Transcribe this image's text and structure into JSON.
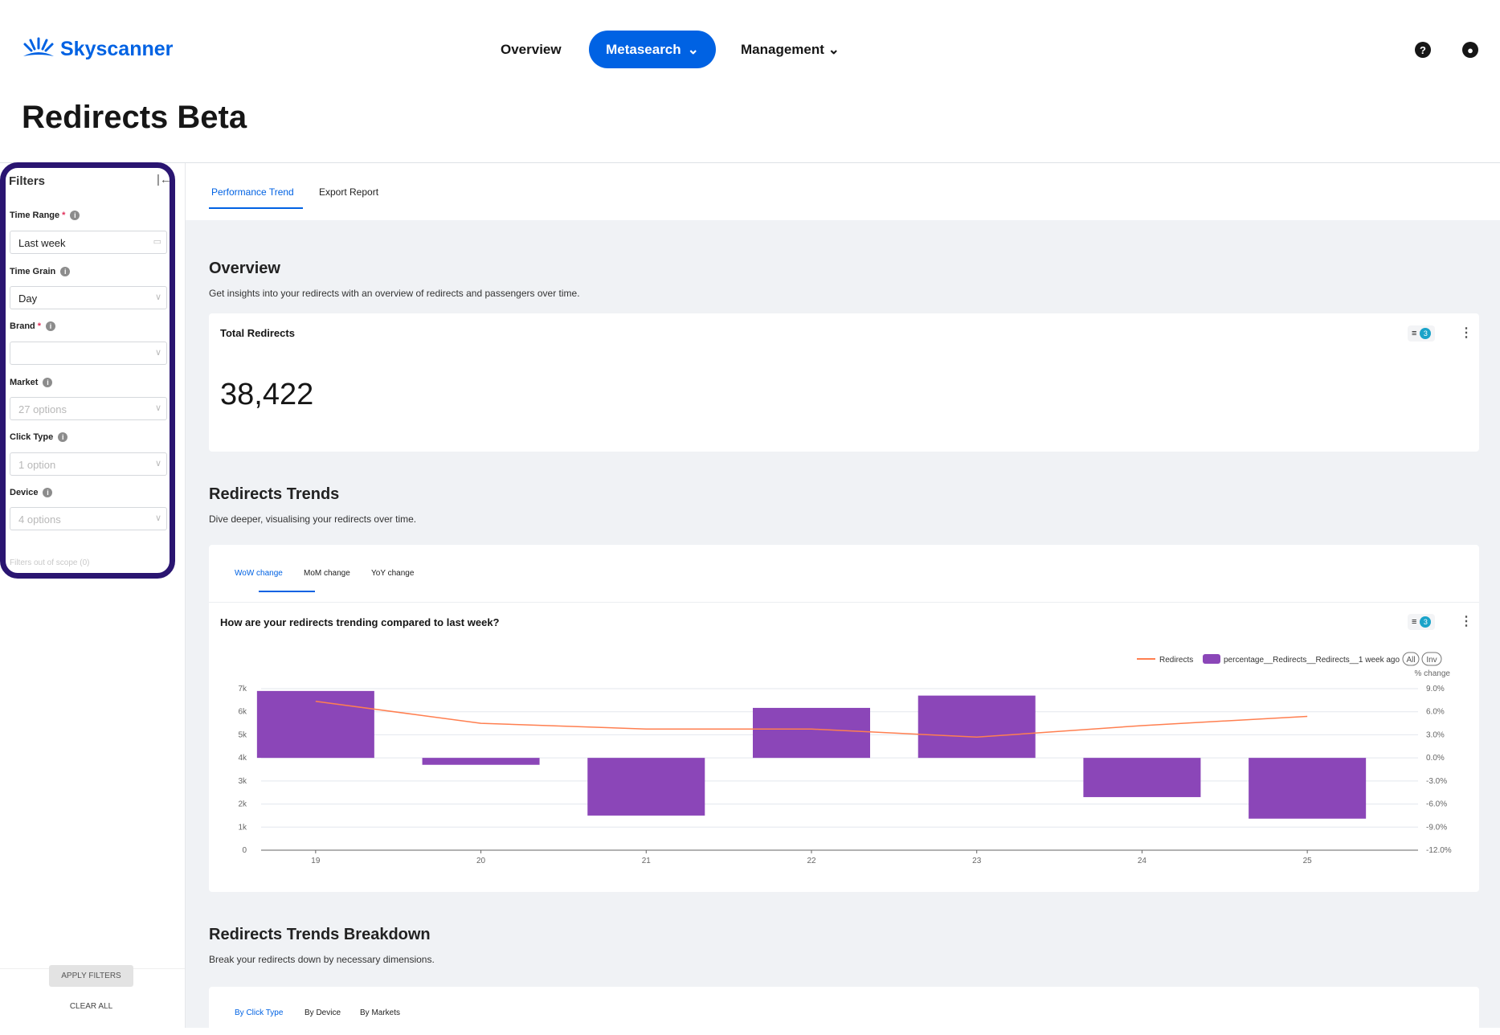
{
  "header": {
    "brand": "Skyscanner",
    "nav": [
      {
        "label": "Overview"
      },
      {
        "label": "Metasearch"
      },
      {
        "label": "Management"
      }
    ],
    "icons": [
      "help-icon",
      "account-icon"
    ]
  },
  "page_title": "Redirects Beta",
  "filters": {
    "title": "Filters",
    "fields": [
      {
        "label": "Time Range",
        "required": true,
        "value": "Last week",
        "placeholder": ""
      },
      {
        "label": "Time Grain",
        "required": false,
        "value": "Day",
        "placeholder": ""
      },
      {
        "label": "Brand",
        "required": true,
        "value": "",
        "placeholder": ""
      },
      {
        "label": "Market",
        "required": false,
        "value": "",
        "placeholder": "27 options"
      },
      {
        "label": "Click Type",
        "required": false,
        "value": "",
        "placeholder": "1 option"
      },
      {
        "label": "Device",
        "required": false,
        "value": "",
        "placeholder": "4 options"
      }
    ],
    "out_of_scope": "Filters out of scope (0)",
    "apply_label": "APPLY FILTERS",
    "clear_label": "CLEAR ALL",
    "outline_color": "#2a1571"
  },
  "tabs": [
    {
      "label": "Performance Trend",
      "active": true
    },
    {
      "label": "Export Report",
      "active": false
    }
  ],
  "overview": {
    "heading": "Overview",
    "description": "Get insights into your redirects with an overview of redirects and passengers over time.",
    "card_title": "Total Redirects",
    "total": "38,422",
    "filter_count": "3"
  },
  "trends": {
    "heading": "Redirects Trends",
    "description": "Dive deeper, visualising your redirects over time.",
    "subtabs": [
      {
        "label": "WoW change",
        "active": true
      },
      {
        "label": "MoM change"
      },
      {
        "label": "YoY change"
      }
    ],
    "chart_title": "How are your redirects trending compared to last week?",
    "filter_count": "3",
    "legend_all": "All",
    "legend_inv": "Inv"
  },
  "breakdown": {
    "heading": "Redirects Trends Breakdown",
    "description": "Break your redirects down by necessary dimensions.",
    "subtabs": [
      {
        "label": "By Click Type",
        "active": true
      },
      {
        "label": "By Device"
      },
      {
        "label": "By Markets"
      }
    ]
  },
  "chart_data": {
    "type": "bar+line",
    "categories": [
      "19",
      "20",
      "21",
      "22",
      "23",
      "24",
      "25"
    ],
    "series": [
      {
        "name": "Redirects",
        "type": "line",
        "axis": "left",
        "color": "#ff7f50",
        "values": [
          6450,
          5500,
          5250,
          5250,
          4900,
          5400,
          5800
        ]
      },
      {
        "name": "percentage__Redirects__Redirects__1 week ago",
        "type": "bar",
        "axis": "right",
        "color": "#8b46b8",
        "values": [
          8.7,
          -0.9,
          -7.5,
          6.5,
          8.1,
          -5.1,
          -7.9
        ]
      }
    ],
    "y_left": {
      "range": [
        0,
        7000
      ],
      "ticks": [
        "0",
        "1k",
        "2k",
        "3k",
        "4k",
        "5k",
        "6k",
        "7k"
      ]
    },
    "y_right": {
      "label": "% change",
      "range": [
        -12,
        9
      ],
      "ticks": [
        "-12.0%",
        "-9.0%",
        "-6.0%",
        "-3.0%",
        "0.0%",
        "3.0%",
        "6.0%",
        "9.0%"
      ]
    },
    "grid": true,
    "legend": "top-right"
  }
}
